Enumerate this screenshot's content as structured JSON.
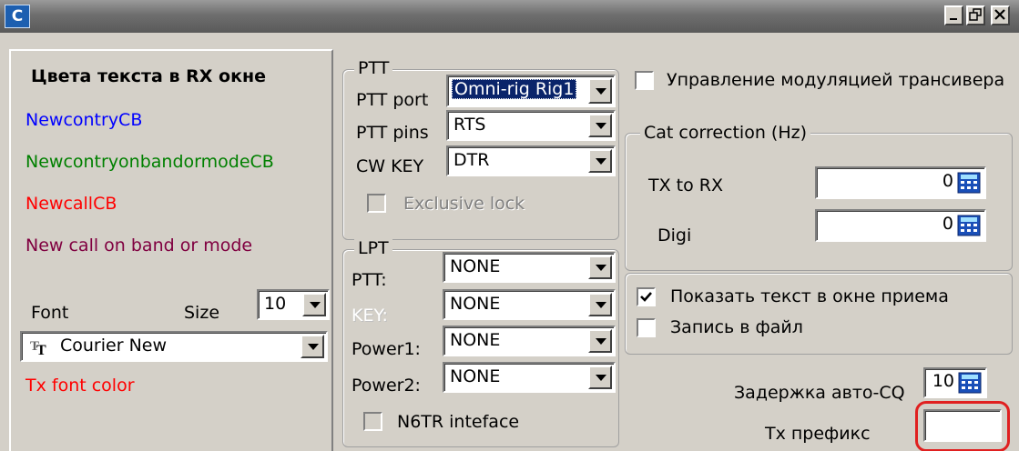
{
  "window": {
    "app_icon_glyph": "C",
    "controls": [
      "minimize-icon",
      "restore-icon",
      "close-icon"
    ]
  },
  "rx_colors": {
    "title": "Цвета текста в RX окне",
    "items": [
      {
        "label": "NewcontryCB",
        "color": "#0000ff"
      },
      {
        "label": "NewcontryonbandormodeCB",
        "color": "#008000"
      },
      {
        "label": "NewcallCB",
        "color": "#ff0000"
      },
      {
        "label": "New call on band or mode",
        "color": "#800040"
      }
    ],
    "font_label": "Font",
    "size_label": "Size",
    "size_value": "10",
    "font_value": "Courier New",
    "font_type_icon": "truetype-font-icon",
    "tx_font_color_label": "Tx font color",
    "tx_font_color": "#ff0000"
  },
  "ptt": {
    "legend": "PTT",
    "port_label": "PTT port",
    "port_value": "Omni-rig Rig1",
    "pins_label": "PTT pins",
    "pins_value": "RTS",
    "cwkey_label": "CW KEY",
    "cwkey_value": "DTR",
    "exclusive_lock_label": "Exclusive lock"
  },
  "lpt": {
    "legend": "LPT",
    "ptt_label": "PTT:",
    "ptt_value": "NONE",
    "key_label": "KEY:",
    "key_value": "NONE",
    "power1_label": "Power1:",
    "power1_value": "NONE",
    "power2_label": "Power2:",
    "power2_value": "NONE",
    "n6tr_label": "N6TR inteface"
  },
  "right": {
    "modulation_label": "Управление модуляцией трансивера",
    "cat_legend": "Cat correction (Hz)",
    "tx_to_rx_label": "TX to RX",
    "tx_to_rx_value": "0",
    "digi_label": "Digi",
    "digi_value": "0",
    "show_text_label": "Показать текст в окне приема",
    "show_text_checked": true,
    "write_file_label": "Запись в файл",
    "write_file_checked": false,
    "autocq_label": "Задержка авто-CQ",
    "autocq_value": "10",
    "tx_prefix_label": "Tx префикс",
    "tx_prefix_value": "",
    "highlight_color": "#e02020"
  }
}
